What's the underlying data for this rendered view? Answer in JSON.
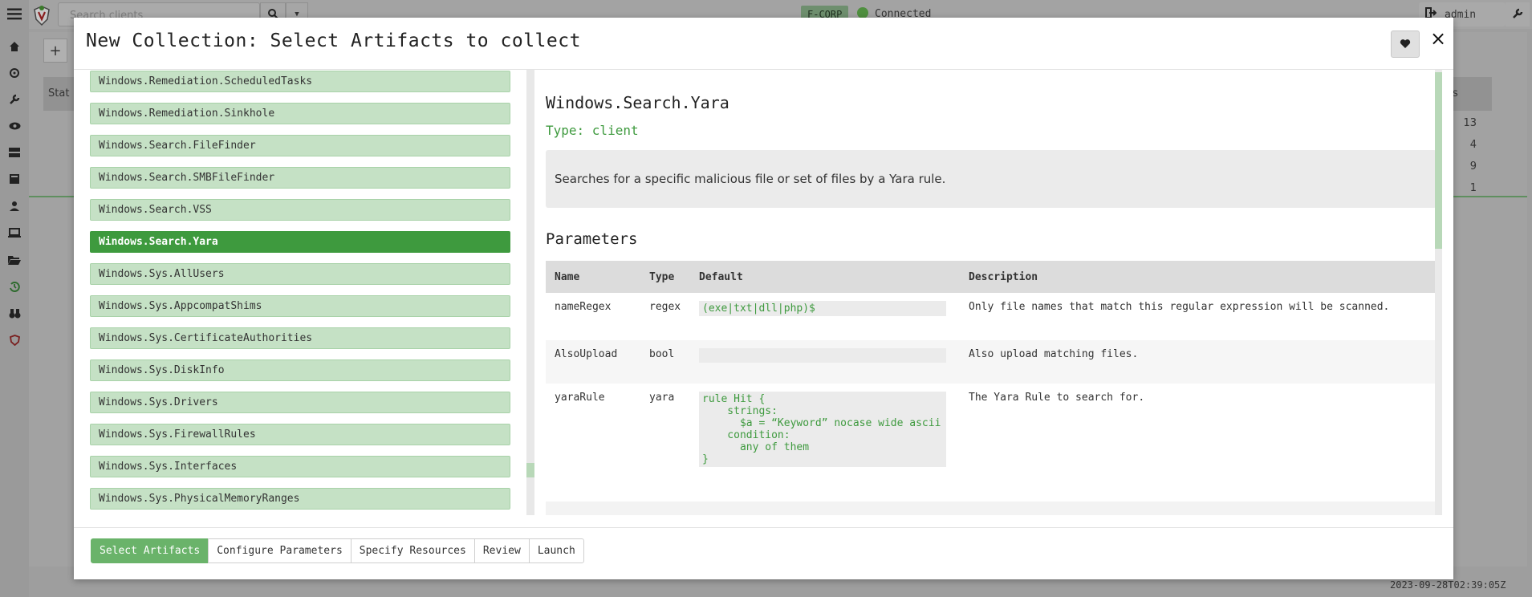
{
  "app": {
    "search_placeholder": "Search clients",
    "org": "F-CORP",
    "connection_status": "Connected",
    "user": "admin",
    "timestamp": "2023-09-28T02:39:05Z",
    "bg_table_header_start": "Stat",
    "bg_table_header_end": "s",
    "bg_counts": [
      "13",
      "4",
      "9",
      "1"
    ]
  },
  "modal": {
    "title": "New Collection: Select Artifacts to collect",
    "close_label": "×"
  },
  "artifacts": [
    {
      "label": "Windows.Remediation.ScheduledTasks",
      "selected": false
    },
    {
      "label": "Windows.Remediation.Sinkhole",
      "selected": false
    },
    {
      "label": "Windows.Search.FileFinder",
      "selected": false
    },
    {
      "label": "Windows.Search.SMBFileFinder",
      "selected": false
    },
    {
      "label": "Windows.Search.VSS",
      "selected": false
    },
    {
      "label": "Windows.Search.Yara",
      "selected": true
    },
    {
      "label": "Windows.Sys.AllUsers",
      "selected": false
    },
    {
      "label": "Windows.Sys.AppcompatShims",
      "selected": false
    },
    {
      "label": "Windows.Sys.CertificateAuthorities",
      "selected": false
    },
    {
      "label": "Windows.Sys.DiskInfo",
      "selected": false
    },
    {
      "label": "Windows.Sys.Drivers",
      "selected": false
    },
    {
      "label": "Windows.Sys.FirewallRules",
      "selected": false
    },
    {
      "label": "Windows.Sys.Interfaces",
      "selected": false
    },
    {
      "label": "Windows.Sys.PhysicalMemoryRanges",
      "selected": false
    }
  ],
  "detail": {
    "title": "Windows.Search.Yara",
    "type": "Type: client",
    "description": "Searches for a specific malicious file or set of files by a Yara rule.",
    "params_title": "Parameters",
    "columns": {
      "name": "Name",
      "type": "Type",
      "default": "Default",
      "description": "Description"
    },
    "params": [
      {
        "name": "nameRegex",
        "type": "regex",
        "default": "(exe|txt|dll|php)$",
        "description": "Only file names that match this regular expression will be scanned."
      },
      {
        "name": "AlsoUpload",
        "type": "bool",
        "default": "",
        "description": "Also upload matching files."
      },
      {
        "name": "yaraRule",
        "type": "yara",
        "default": "rule Hit {\n    strings:\n      $a = “Keyword” nocase wide ascii\n    condition:\n      any of them\n}",
        "description": "The Yara Rule to search for."
      }
    ]
  },
  "steps": [
    {
      "label": "Select Artifacts",
      "active": true
    },
    {
      "label": "Configure Parameters",
      "active": false
    },
    {
      "label": "Specify Resources",
      "active": false
    },
    {
      "label": "Review",
      "active": false
    },
    {
      "label": "Launch",
      "active": false
    }
  ],
  "icons": {
    "menu": "hamburger-icon",
    "search": "search-icon",
    "heart": "heart-icon"
  }
}
